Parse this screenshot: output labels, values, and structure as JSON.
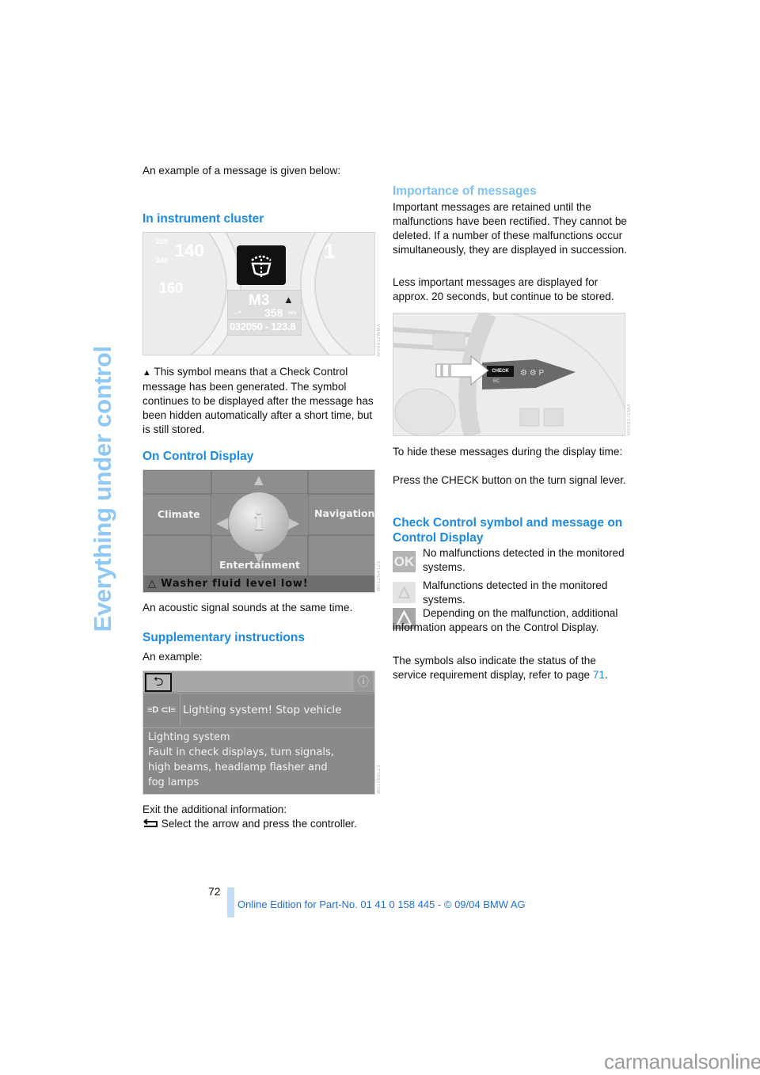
{
  "side_title": "Everything under control",
  "left": {
    "intro": "An example of a message is given below:",
    "instrument_cluster": {
      "heading": "In instrument cluster",
      "figure": {
        "gauge_labels": [
          "220",
          "140",
          "240",
          "160",
          "1"
        ],
        "model": "M3",
        "range": "358",
        "range_unit": "mls",
        "odometer": "032050 - 123.8",
        "figure_code": "MV0012WMA"
      },
      "note": "This symbol means that a Check Control message has been generated. The symbol continues to be displayed after the message has been hidden automatically after a short time, but is still stored."
    },
    "control_display": {
      "heading": "On Control Display",
      "figure": {
        "menu_left": "Climate",
        "menu_right": "Navigation",
        "menu_bottom": "Entertainment",
        "center_icon": "i",
        "warning_message": "Washer fluid level low!",
        "figure_code": "W012NA123"
      },
      "note": "An acoustic signal sounds at the same time."
    },
    "supplementary": {
      "heading": "Supplementary instructions",
      "example_label": "An example:",
      "figure": {
        "back_icon": "back-arrow",
        "info_icon": "i",
        "lights_icon": "≡D ⊂I≡",
        "title": "Lighting system! Stop vehicle",
        "body_lines": [
          "Lighting system",
          "Fault in check displays, turn signals,",
          "high beams, headlamp flasher and",
          "fog lamps"
        ],
        "figure_code": "W01086L23"
      },
      "exit_label": "Exit the additional information:",
      "exit_instruction": "Select the arrow and press the controller."
    }
  },
  "right": {
    "importance": {
      "heading": "Importance of messages",
      "paragraph1": "Important messages are retained until the malfunctions have been rectified. They cannot be deleted. If a number of these malfunctions occur simultaneously, they are displayed in succession.",
      "paragraph2": "Less important messages are displayed for approx. 20 seconds, but continue to be stored.",
      "figure": {
        "button_label": "CHECK",
        "lower_label": "BC",
        "figure_code": "MV0017CMA"
      },
      "hide_intro": "To hide these messages during the display time:",
      "hide_instruction": "Press the CHECK button on the turn signal lever."
    },
    "check_control": {
      "heading": "Check Control symbol and message on Control Display",
      "items": [
        {
          "icon": "ok",
          "icon_text": "OK",
          "text": "No malfunctions detected in the monitored systems."
        },
        {
          "icon": "warning-light",
          "text": "Malfunctions detected in the monitored systems."
        },
        {
          "icon": "warning-dark",
          "text": "Depending on the malfunction, additional information appears on the Control Display."
        }
      ],
      "status_text_prefix": "The symbols also indicate the status of the service requirement display, refer to page ",
      "status_link": "71",
      "status_text_suffix": "."
    }
  },
  "footer": {
    "page_number": "72",
    "edition": "Online Edition for Part-No. 01 41 0 158 445 - © 09/04 BMW AG",
    "watermark": "carmanualsonline.info"
  },
  "colors": {
    "heading": "#1a8ae6",
    "heading_light": "#7fc0f2",
    "side_title": "#8fc8f4",
    "link": "#1a8ae6"
  }
}
